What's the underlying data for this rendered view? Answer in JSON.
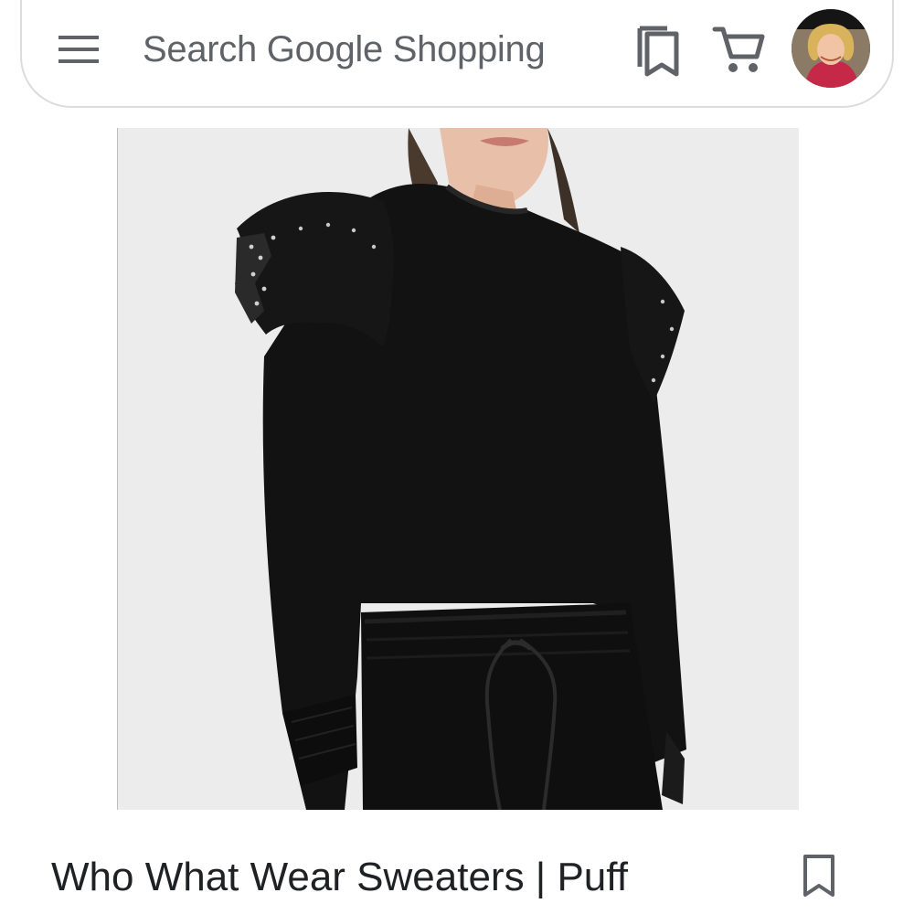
{
  "header": {
    "menu_icon": "hamburger-menu-icon",
    "search_placeholder": "Search Google Shopping",
    "bookmarks_icon": "bookmarks-icon",
    "cart_icon": "shopping-cart-icon",
    "avatar_icon": "user-avatar"
  },
  "product": {
    "image_alt": "black sweatshirt with eyelet ruffle shoulders",
    "title": "Who What Wear Sweaters | Puff",
    "save_icon": "bookmark-icon"
  },
  "colors": {
    "text_primary": "#202124",
    "text_secondary": "#5f6368",
    "border": "#dadce0",
    "image_bg": "#ececec",
    "garment": "#111111"
  }
}
